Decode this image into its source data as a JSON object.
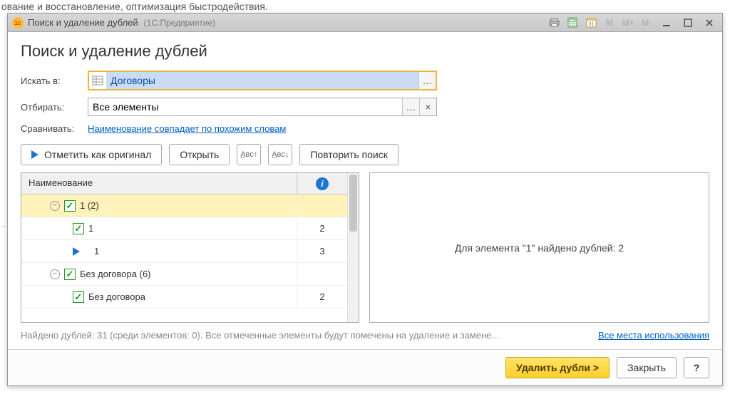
{
  "background_text": "ование и восстановление, оптимизация быстродействия.",
  "window": {
    "title": "Поиск и удаление дублей",
    "subtitle": "(1С:Предприятие)"
  },
  "titlebar_icons": {
    "m1": "M",
    "m2": "M+",
    "m3": "M-"
  },
  "page_title": "Поиск и удаление дублей",
  "labels": {
    "search_in": "Искать в:",
    "filter": "Отбирать:",
    "compare": "Сравнивать:"
  },
  "fields": {
    "search_in_value": "Договоры",
    "filter_value": "Все элементы"
  },
  "compare_link": "Наименование совпадает по похожим словам",
  "toolbar": {
    "mark_original": "Отметить как оригинал",
    "open": "Открыть",
    "repeat_search": "Повторить поиск"
  },
  "tree": {
    "header_name": "Наименование",
    "rows": [
      {
        "lvl": 1,
        "expander": "-",
        "check": true,
        "label": "1 (2)",
        "info": "",
        "selected": true
      },
      {
        "lvl": 2,
        "check": true,
        "label": "1",
        "info": "2"
      },
      {
        "lvl": 2,
        "origin": true,
        "label": "1",
        "info": "3"
      },
      {
        "lvl": 1,
        "expander": "-",
        "check": true,
        "label": "Без договора (6)",
        "info": ""
      },
      {
        "lvl": 2,
        "check": true,
        "label": "Без договора",
        "info": "2"
      }
    ]
  },
  "details_text": "Для элемента \"1\" найдено дублей: 2",
  "status": {
    "text": "Найдено дублей: 31 (среди элементов: 0). Все отмеченные элементы будут помечены на удаление и замене...",
    "link": "Все места использования"
  },
  "footer": {
    "delete": "Удалить дубли >",
    "close": "Закрыть",
    "help": "?"
  }
}
